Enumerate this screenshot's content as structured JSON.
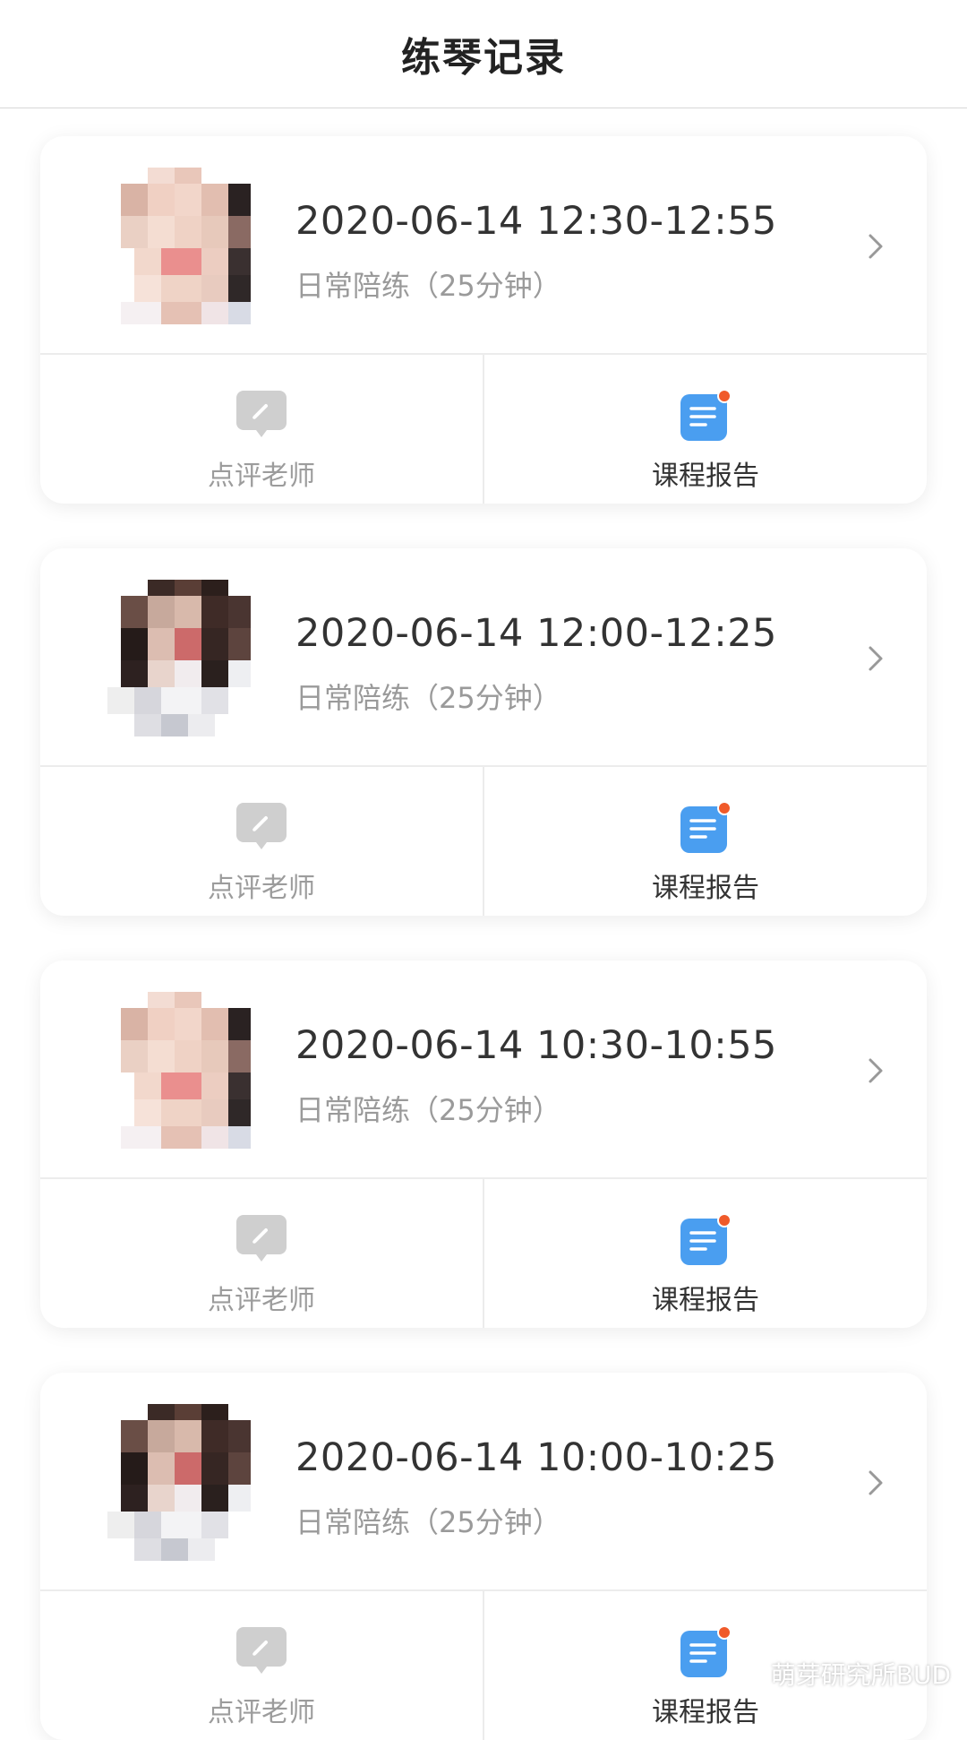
{
  "header": {
    "title": "练琴记录"
  },
  "records": [
    {
      "time": "2020-06-14 12:30-12:55",
      "type": "日常陪练（25分钟）",
      "review_label": "点评老师",
      "report_label": "课程报告",
      "avatar_style": "light"
    },
    {
      "time": "2020-06-14 12:00-12:25",
      "type": "日常陪练（25分钟）",
      "review_label": "点评老师",
      "report_label": "课程报告",
      "avatar_style": "dark"
    },
    {
      "time": "2020-06-14 10:30-10:55",
      "type": "日常陪练（25分钟）",
      "review_label": "点评老师",
      "report_label": "课程报告",
      "avatar_style": "light"
    },
    {
      "time": "2020-06-14 10:00-10:25",
      "type": "日常陪练（25分钟）",
      "review_label": "点评老师",
      "report_label": "课程报告",
      "avatar_style": "dark"
    }
  ],
  "watermark": {
    "text": "萌芽研究所BUD"
  },
  "colors": {
    "report_icon": "#4a9ef0",
    "badge_dot": "#f05a2a",
    "review_icon": "#cfcfcf",
    "secondary_text": "#9a9a9a"
  }
}
